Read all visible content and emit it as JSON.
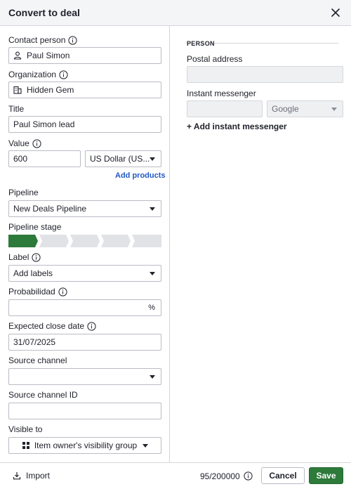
{
  "dialog": {
    "title": "Convert to deal"
  },
  "form": {
    "contact_person": {
      "label": "Contact person",
      "value": "Paul Simon"
    },
    "organization": {
      "label": "Organization",
      "value": "Hidden Gem"
    },
    "title": {
      "label": "Title",
      "value": "Paul Simon lead"
    },
    "value": {
      "label": "Value",
      "amount": "600",
      "currency": "US Dollar (US..."
    },
    "add_products": "Add products",
    "pipeline": {
      "label": "Pipeline",
      "value": "New Deals Pipeline"
    },
    "pipeline_stage": {
      "label": "Pipeline stage",
      "stage_count": 5,
      "active_stage": 1
    },
    "label": {
      "label": "Label",
      "placeholder": "Add labels"
    },
    "probability": {
      "label": "Probabilidad",
      "value": "",
      "suffix": "%"
    },
    "expected_close_date": {
      "label": "Expected close date",
      "value": "31/07/2025"
    },
    "source_channel": {
      "label": "Source channel",
      "value": ""
    },
    "source_channel_id": {
      "label": "Source channel ID",
      "value": ""
    },
    "visible_to": {
      "label": "Visible to",
      "value": "Item owner's visibility group"
    }
  },
  "person": {
    "heading": "PERSON",
    "postal_address": {
      "label": "Postal address",
      "value": ""
    },
    "instant_messenger": {
      "label": "Instant messenger",
      "value": "",
      "service": "Google"
    },
    "add_messenger": "+ Add instant messenger"
  },
  "footer": {
    "import_label": "Import",
    "counter": "95/200000",
    "cancel_label": "Cancel",
    "save_label": "Save"
  },
  "colors": {
    "accent": "#2d7a3a",
    "link": "#2058c4",
    "border": "#b9bcc4"
  }
}
